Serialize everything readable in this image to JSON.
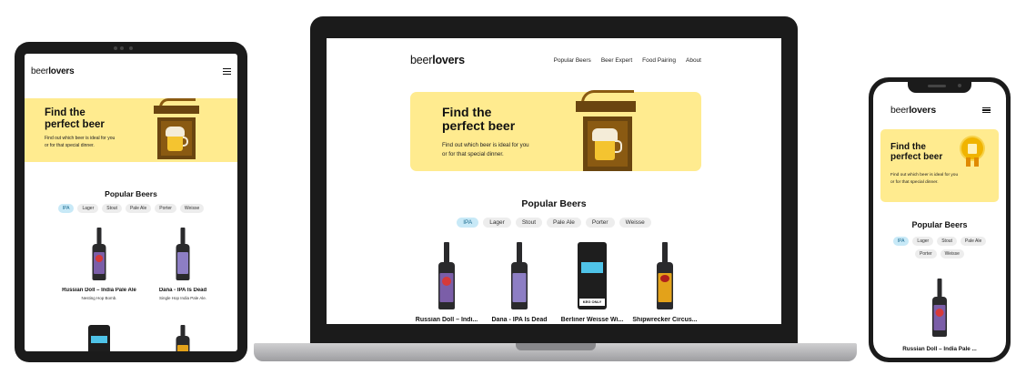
{
  "brand": {
    "logo_prefix": "beer",
    "logo_suffix": "lovers"
  },
  "nav": {
    "items": [
      "Popular Beers",
      "Beer Expert",
      "Food Pairing",
      "About"
    ]
  },
  "hero": {
    "title_line1": "Find the",
    "title_line2": "perfect beer",
    "text_line1": "Find out which beer is ideal for you",
    "text_line2": "or for that special dinner."
  },
  "popular": {
    "title": "Popular Beers"
  },
  "tags": [
    {
      "label": "IPA",
      "active": true
    },
    {
      "label": "Lager",
      "active": false
    },
    {
      "label": "Stout",
      "active": false
    },
    {
      "label": "Pale Ale",
      "active": false
    },
    {
      "label": "Porter",
      "active": false
    },
    {
      "label": "Weisse",
      "active": false
    }
  ],
  "beers": [
    {
      "name": "Russian Doll – India Pale Ale",
      "laptop_name": "Russian Doll – Indi...",
      "phone_name": "Russian Doll – India Pale ...",
      "desc": "Nesting Hop Bomb.",
      "label_color": "#7b5ea8"
    },
    {
      "name": "Dana - IPA Is Dead",
      "laptop_name": "Dana - IPA Is Dead",
      "desc": "Single Hop India Pale Ale.",
      "label_color": "#8d7ec4"
    },
    {
      "name": "Berliner Weisse Wi...",
      "laptop_name": "Berliner Weisse Wi...",
      "desc": "",
      "label_color": "#4fc3e8",
      "keg_text": "KEG ONLY"
    },
    {
      "name": "Shipwrecker Circus...",
      "laptop_name": "Shipwrecker Circus...",
      "desc": "",
      "label_color": "#e3a21a"
    }
  ],
  "colors": {
    "hero_bg": "#ffeb8f",
    "tag_active_bg": "#c8e9f7",
    "device_frame": "#1b1b1b"
  }
}
